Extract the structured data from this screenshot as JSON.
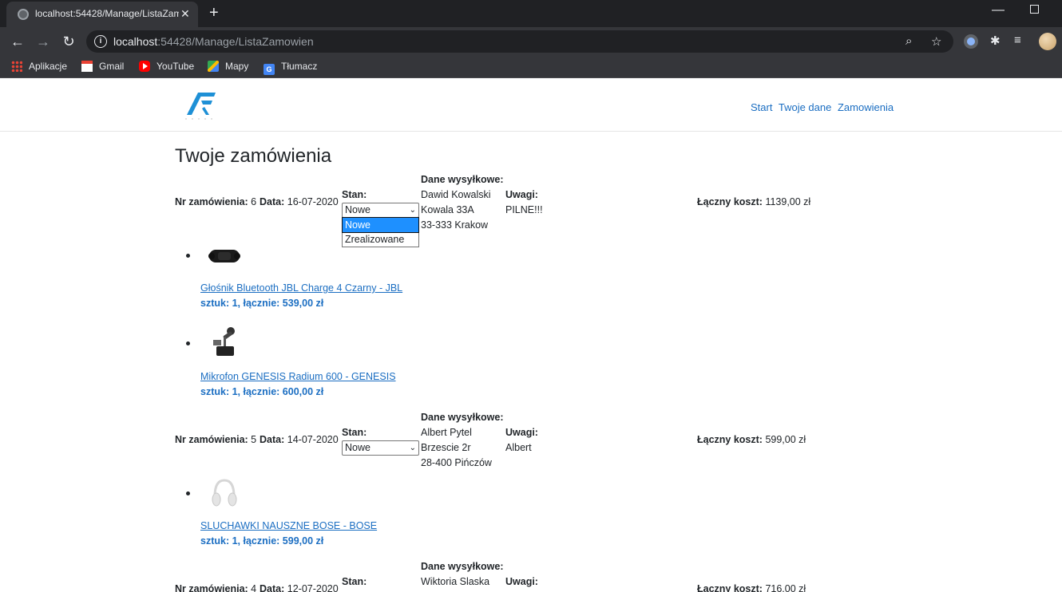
{
  "browser": {
    "tab_title": "localhost:54428/Manage/ListaZamowien",
    "url_host": "localhost",
    "url_rest": ":54428/Manage/ListaZamowien",
    "bookmarks": [
      "Aplikacje",
      "Gmail",
      "YouTube",
      "Mapy",
      "Tłumacz"
    ]
  },
  "nav": {
    "links": [
      "Start",
      "Twoje dane",
      "Zamowienia"
    ]
  },
  "page_title": "Twoje zamówienia",
  "labels": {
    "order_no": "Nr zamówienia:",
    "date": "Data:",
    "stan": "Stan:",
    "shipping": "Dane wysyłkowe:",
    "notes": "Uwagi:",
    "total": "Łączny koszt:"
  },
  "status_options": [
    "Nowe",
    "Zrealizowane"
  ],
  "orders": [
    {
      "number": "6",
      "date": "16-07-2020",
      "status": "Nowe",
      "shipping": [
        "Dawid Kowalski",
        "Kowala 33A",
        "33-333 Krakow"
      ],
      "notes": "PILNE!!!",
      "total": "1139,00 zł",
      "items": [
        {
          "name": "Głośnik Bluetooth JBL Charge 4 Czarny - JBL",
          "qty": "sztuk: 1, łącznie: 539,00 zł",
          "icon": "speaker-image"
        },
        {
          "name": "Mikrofon GENESIS Radium 600 - GENESIS",
          "qty": "sztuk: 1, łącznie: 600,00 zł",
          "icon": "microphone-image"
        }
      ]
    },
    {
      "number": "5",
      "date": "14-07-2020",
      "status": "Nowe",
      "shipping": [
        "Albert Pytel",
        "Brzescie 2r",
        "28-400 Pińczów"
      ],
      "notes": "Albert",
      "total": "599,00 zł",
      "items": [
        {
          "name": "SLUCHAWKI NAUSZNE BOSE - BOSE",
          "qty": "sztuk: 1, łącznie: 599,00 zł",
          "icon": "headphones-image"
        }
      ]
    },
    {
      "number": "4",
      "date": "12-07-2020",
      "shipping": [
        "Wiktoria Slaska"
      ],
      "total": "716,00 zł"
    }
  ]
}
